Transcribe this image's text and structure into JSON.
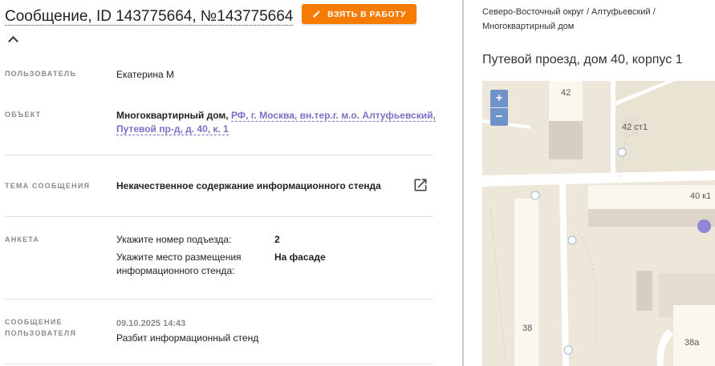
{
  "header": {
    "title": "Сообщение, ID 143775664, №143775664",
    "action_button": "ВЗЯТЬ В РАБОТУ"
  },
  "fields": {
    "user_label": "ПОЛЬЗОВАТЕЛЬ",
    "user_value": "Екатерина М",
    "object_label": "ОБЪЕКТ",
    "object_type": "Многоквартирный дом,",
    "object_address_line1": "РФ, г. Москва, вн.тер.г. м.о. Алтуфьевский,",
    "object_address_line2": "Путевой пр-д, д. 40, к. 1",
    "topic_label": "ТЕМА СООБЩЕНИЯ",
    "topic_value": "Некачественное содержание информационного стенда",
    "survey_label": "АНКЕТА",
    "survey": [
      {
        "question": "Укажите номер подъезда:",
        "answer": "2"
      },
      {
        "question": "Укажите место размещения информационного стенда:",
        "answer": "На фасаде"
      }
    ],
    "message_label_line1": "СООБЩЕНИЕ",
    "message_label_line2": "ПОЛЬЗОВАТЕЛЯ",
    "message_date": "09.10.2025 14:43",
    "message_text": "Разбит информационный стенд"
  },
  "right_panel": {
    "breadcrumb_line1": "Северо-Восточный округ / Алтуфьевский /",
    "breadcrumb_line2": "Многоквартирный дом",
    "address_title": "Путевой проезд, дом 40, корпус 1",
    "map": {
      "zoom_in": "+",
      "zoom_out": "−",
      "labels": [
        "42",
        "42 ст1",
        "40 к1",
        "38",
        "38а"
      ],
      "marker_color": "#8f86d6"
    }
  },
  "colors": {
    "accent_orange": "#f57c00",
    "link_purple": "#7b6fc7"
  }
}
